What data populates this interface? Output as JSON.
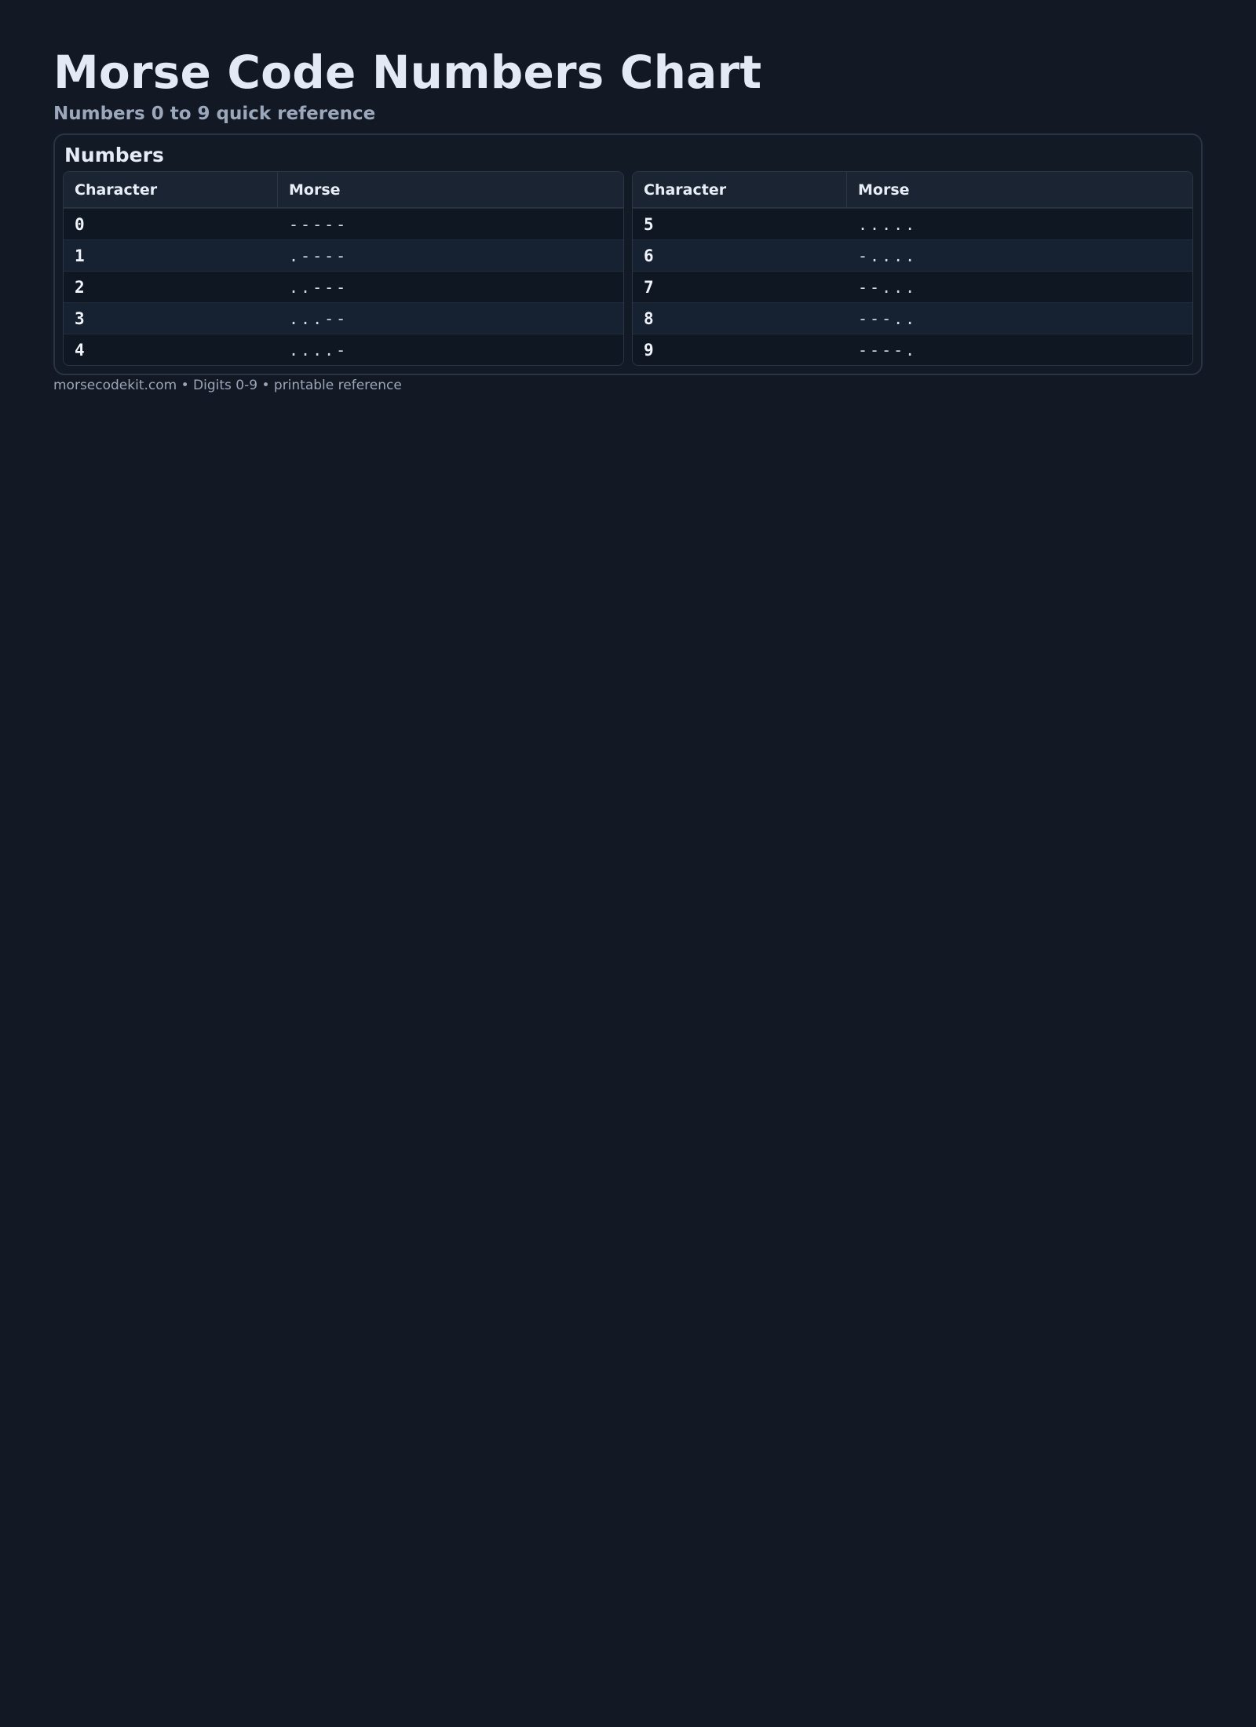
{
  "header": {
    "title": "Morse Code Numbers Chart",
    "subtitle": "Numbers 0 to 9 quick reference"
  },
  "panel": {
    "title": "Numbers",
    "tables": [
      {
        "headers": [
          "Character",
          "Morse"
        ],
        "rows": [
          {
            "char": "0",
            "code": "-----"
          },
          {
            "char": "1",
            "code": ".----"
          },
          {
            "char": "2",
            "code": "..---"
          },
          {
            "char": "3",
            "code": "...--"
          },
          {
            "char": "4",
            "code": "....-"
          }
        ]
      },
      {
        "headers": [
          "Character",
          "Morse"
        ],
        "rows": [
          {
            "char": "5",
            "code": "....."
          },
          {
            "char": "6",
            "code": "-...."
          },
          {
            "char": "7",
            "code": "--..."
          },
          {
            "char": "8",
            "code": "---.."
          },
          {
            "char": "9",
            "code": "----."
          }
        ]
      }
    ]
  },
  "footer": {
    "text": "morsecodekit.com • Digits 0-9 • printable reference"
  },
  "colors": {
    "background": "#131924",
    "header_row": "#1b2432",
    "row_even": "#0f1722",
    "row_odd": "#162132"
  }
}
